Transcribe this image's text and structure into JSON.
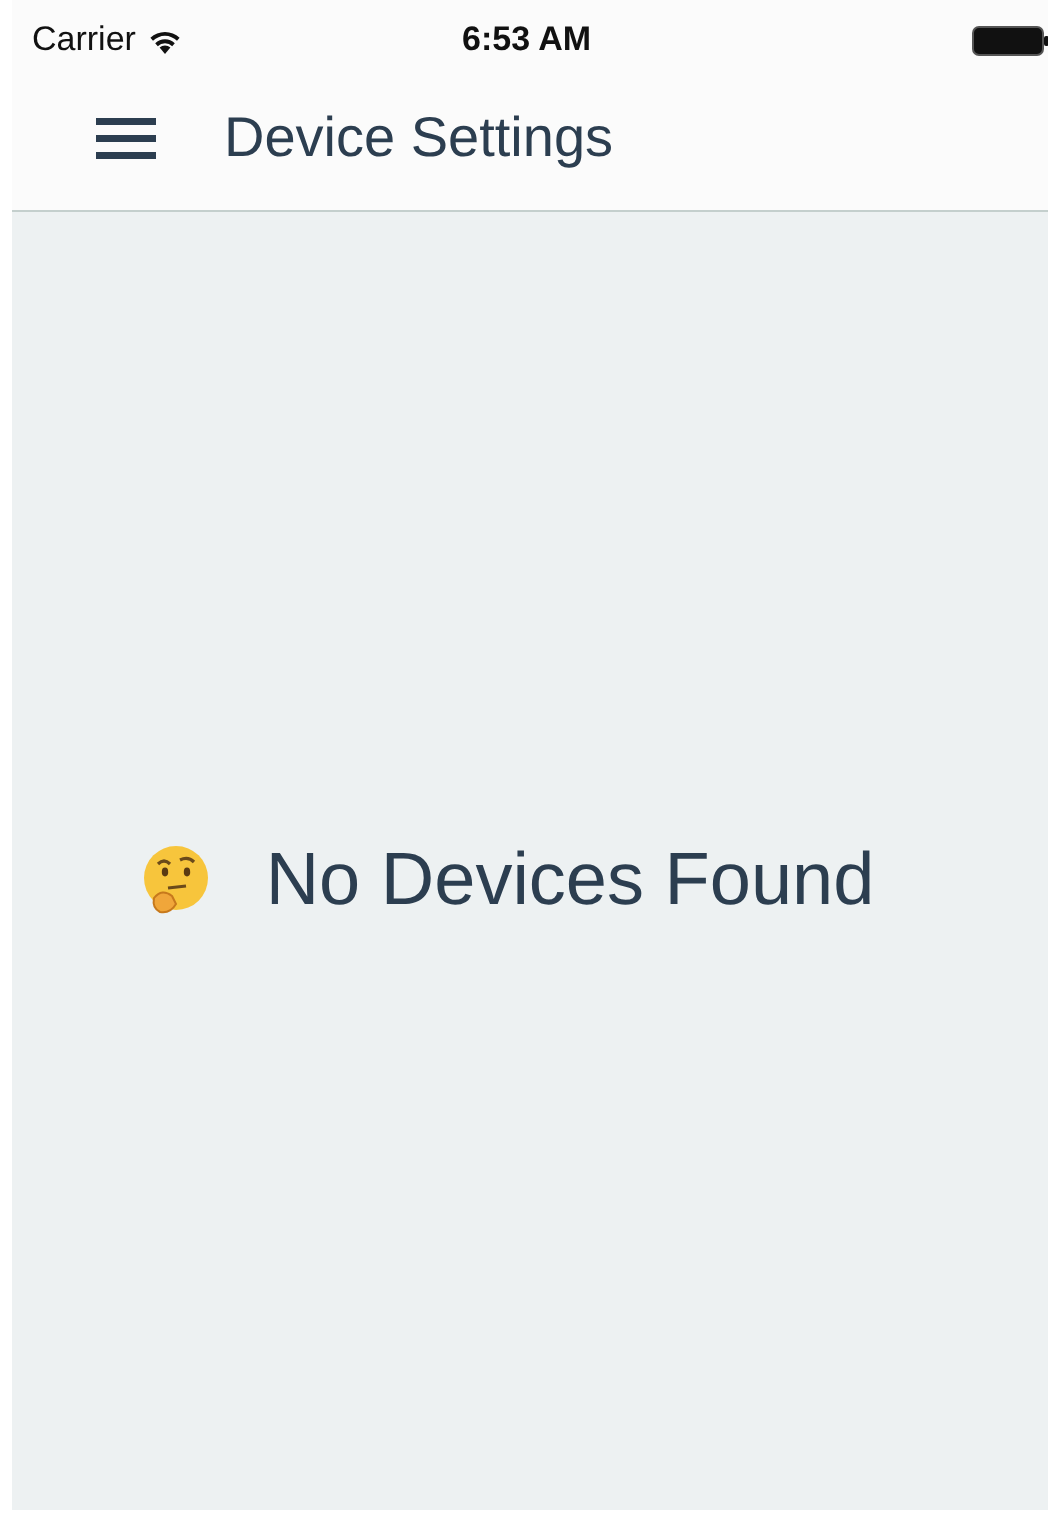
{
  "status_bar": {
    "carrier": "Carrier",
    "time": "6:53 AM"
  },
  "header": {
    "title": "Device Settings"
  },
  "empty_state": {
    "message": "No Devices Found"
  }
}
